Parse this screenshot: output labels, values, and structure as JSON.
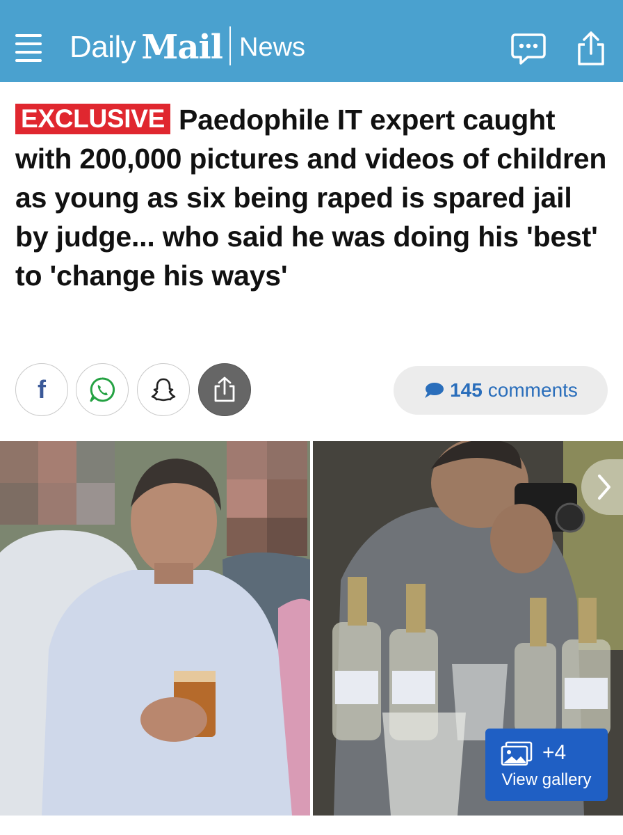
{
  "header": {
    "brand_daily": "Daily",
    "brand_mail": "Mail",
    "section": "News",
    "background_color": "#4aa1cf",
    "icons": [
      "menu-icon",
      "chat-icon",
      "share-icon"
    ]
  },
  "article": {
    "badge": "EXCLUSIVE",
    "badge_color": "#e0272f",
    "headline": "Paedophile IT expert caught with 200,000 pictures and videos of children as young as six being raped is spared jail by judge... who said he was doing his 'best' to 'change his ways'"
  },
  "share": {
    "buttons": [
      "facebook-icon",
      "whatsapp-icon",
      "snapchat-icon",
      "share-icon"
    ],
    "facebook_label": "f",
    "comments_count": "145",
    "comments_label": "comments"
  },
  "gallery": {
    "more_count": "+4",
    "label": "View gallery",
    "accent_color": "#1f5fc4"
  }
}
